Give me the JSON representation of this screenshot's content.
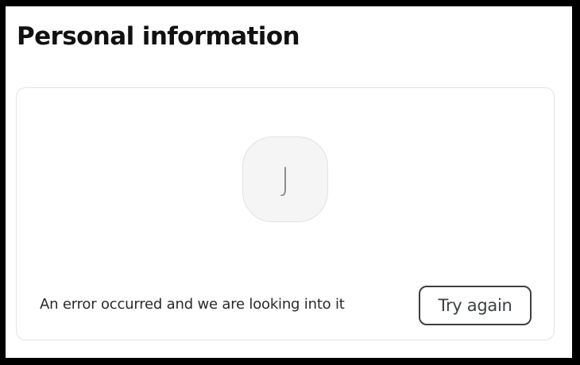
{
  "page": {
    "title": "Personal information"
  },
  "profile_card": {
    "avatar_initial": "J",
    "error_message": "An error occurred and we are looking into it",
    "retry_label": "Try again"
  },
  "colors": {
    "background_frame": "#000000",
    "card_border": "#e4e4e4",
    "avatar_background": "#f5f5f5",
    "button_border": "#3c3f44",
    "text_primary": "#111111"
  }
}
